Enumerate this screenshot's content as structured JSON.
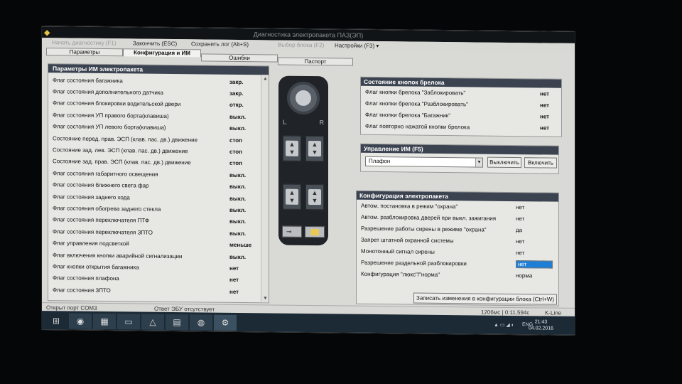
{
  "window": {
    "title": "Диагностика электропакета ПАЗ(ЭП)"
  },
  "menu": {
    "items": [
      {
        "label": "Начать диагностику (F1)",
        "enabled": false
      },
      {
        "label": "Закончить (ESC)",
        "enabled": true
      },
      {
        "label": "Сохранить лог (Alt+S)",
        "enabled": true
      },
      {
        "label": "Выбор блока (F2)",
        "enabled": false
      },
      {
        "label": "Настройки (F3) ▾",
        "enabled": true
      }
    ]
  },
  "tabs": {
    "params": "Параметры",
    "config": "Конфигурация и ИМ",
    "errors": "Ошибки",
    "passport": "Паспорт"
  },
  "left_panel": {
    "title": "Параметры ИМ электропакета",
    "rows": [
      {
        "key": "Флаг состояния багажника",
        "value": "закр."
      },
      {
        "key": "Флаг состояния дополнительного датчика",
        "value": "закр."
      },
      {
        "key": "Флаг состояния блокировки водительской двери",
        "value": "откр."
      },
      {
        "key": "Флаг состояния УП правого борта(клавиша)",
        "value": "выкл."
      },
      {
        "key": "Флаг состояния УП левого борта(клавиша)",
        "value": "выкл."
      },
      {
        "key": "Состояние перед. прав. ЭСП (клав. пас. дв.) движение",
        "value": "стоп"
      },
      {
        "key": "Состояние зад. лев. ЭСП (клав. пас. дв.) движение",
        "value": "стоп"
      },
      {
        "key": "Состояние зад. прав. ЭСП (клав. пас. дв.) движение",
        "value": "стоп"
      },
      {
        "key": "Флаг состояния габаритного освещения",
        "value": "выкл."
      },
      {
        "key": "Флаг состояния ближнего света фар",
        "value": "выкл."
      },
      {
        "key": "Флаг состояния заднего хода",
        "value": "выкл."
      },
      {
        "key": "Флаг состояния обогрева заднего стекла",
        "value": "выкл."
      },
      {
        "key": "Флаг состояния переключателя ПТФ",
        "value": "выкл."
      },
      {
        "key": "Флаг состояния переключателя ЗПТО",
        "value": "выкл."
      },
      {
        "key": "Флаг управления подсветкой",
        "value": "меньше"
      },
      {
        "key": "Флаг включения кнопки аварийной сигнализации",
        "value": "выкл."
      },
      {
        "key": "Флаг кнопки открытия багажника",
        "value": "нет"
      },
      {
        "key": "Флаг состояния плафона",
        "value": "нет"
      },
      {
        "key": "Флаг состояния ЗПТО",
        "value": "нет"
      }
    ]
  },
  "keyfob_panel": {
    "title": "Состояние кнопок брелока",
    "rows": [
      {
        "key": "Флаг кнопки брелока \"Заблокировать\"",
        "value": "нет"
      },
      {
        "key": "Флаг кнопки брелока \"Разблокировать\"",
        "value": "нет"
      },
      {
        "key": "Флаг кнопки брелока \"Багажник\"",
        "value": "нет"
      },
      {
        "key": "Флаг повторно нажатой кнопки брелока",
        "value": "нет"
      }
    ]
  },
  "control_panel": {
    "title": "Управление ИМ (F5)",
    "selected": "Плафон",
    "btn_off": "Выключить",
    "btn_on": "Включить"
  },
  "config_panel": {
    "title": "Конфигурация электропакета",
    "rows": [
      {
        "key": "Автом. постановка в режим \"охрана\"",
        "value": "нет"
      },
      {
        "key": "Автом. разблокировка дверей при выкл. зажигания",
        "value": "нет"
      },
      {
        "key": "Разрешение работы сирены в режиме \"охрана\"",
        "value": "да"
      },
      {
        "key": "Запрет штатной охранной системы",
        "value": "нет"
      },
      {
        "key": "Монотонный сигнал сирены",
        "value": "нет"
      },
      {
        "key": "Разрешение раздельной разблокировки",
        "value": "нет"
      },
      {
        "key": "Конфигурация \"люкс\"/\"норма\"",
        "value": "норма"
      }
    ],
    "save_button": "Записать изменения в конфигурации блока (Ctrl+W)"
  },
  "status": {
    "port": "Открыт порт COM3",
    "answer": "Ответ ЭБУ отсутствует",
    "timing": "1206мс | 0:11,594с",
    "line": "K-Line"
  },
  "taskbar": {
    "lang": "ENG",
    "time": "21:43",
    "date": "04.02.2016"
  }
}
